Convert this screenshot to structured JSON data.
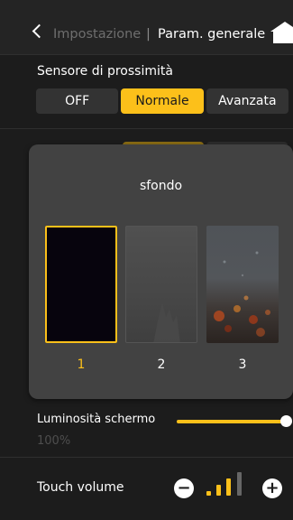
{
  "header": {
    "back_label": "Impostazione",
    "separator": "|",
    "title": "Param. generale"
  },
  "proximity": {
    "label": "Sensore di prossimità",
    "options": [
      "OFF",
      "Normale",
      "Avanzata"
    ],
    "selected": "Normale"
  },
  "wallpaper_dialog": {
    "title": "sfondo",
    "options": [
      "1",
      "2",
      "3"
    ],
    "selected": "1"
  },
  "brightness": {
    "label": "Luminosità schermo",
    "value_text": "100%",
    "level": 1.0
  },
  "touch_volume": {
    "label": "Touch volume",
    "minus": "−",
    "plus": "+",
    "level": 2,
    "max_level": 4
  },
  "colors": {
    "accent": "#fcc01a",
    "background": "#1c1c1c",
    "dialog": "#424242"
  }
}
